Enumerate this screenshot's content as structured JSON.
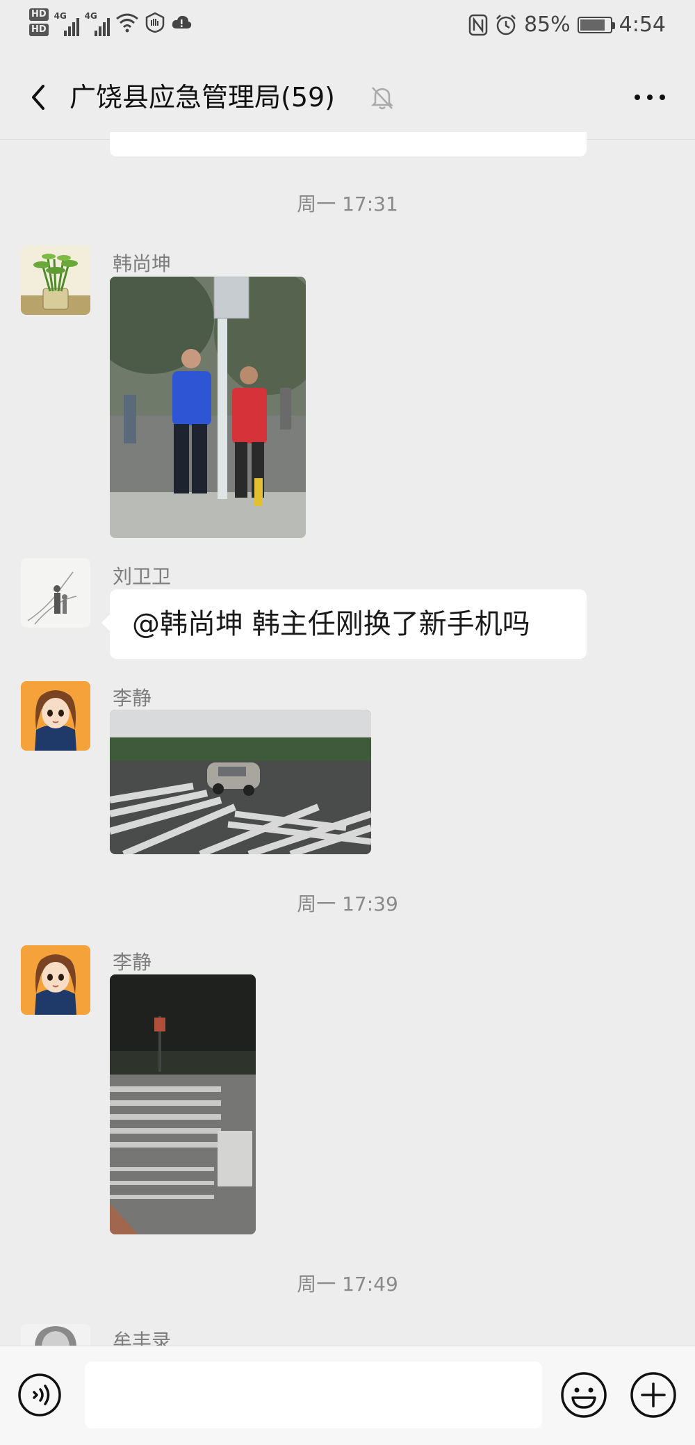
{
  "status_bar": {
    "hd1": "HD",
    "hd2": "HD",
    "net1": "4G",
    "net2": "4G",
    "battery_pct": "85%",
    "battery_level": 0.85,
    "time": "4:54"
  },
  "header": {
    "title": "广饶县应急管理局(59)",
    "muted": true
  },
  "messages": {
    "t1": "周一 17:31",
    "m1_sender": "韩尚坤",
    "m2_sender": "刘卫卫",
    "m2_text": "@韩尚坤  韩主任刚换了新手机吗",
    "m3_sender": "李静",
    "t2": "周一 17:39",
    "m4_sender": "李静",
    "t3": "周一 17:49",
    "m5_sender": "牟丰录"
  },
  "input_bar": {
    "text_value": ""
  },
  "colors": {
    "background": "#ededed",
    "bubble": "#ffffff",
    "timestamp": "#8a8a8a"
  }
}
